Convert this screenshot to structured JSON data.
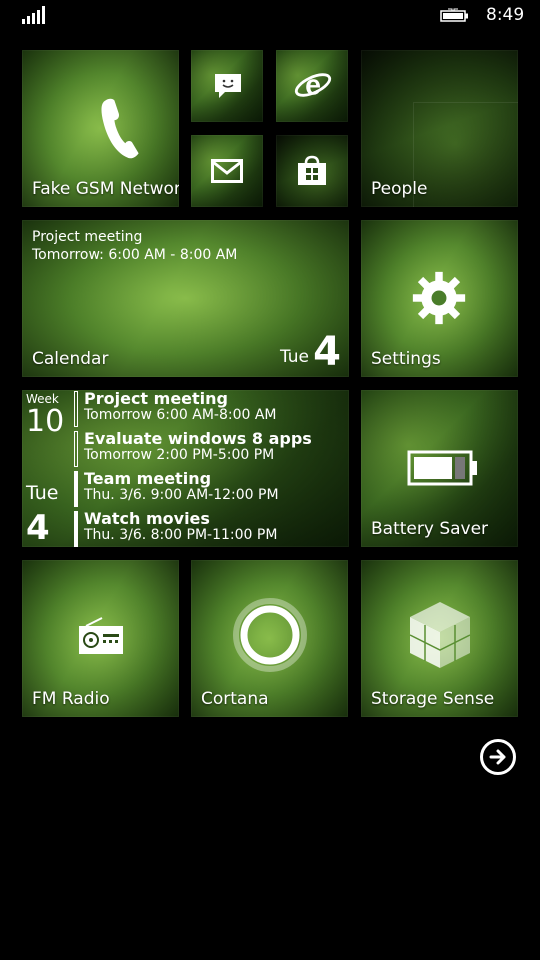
{
  "status_bar": {
    "time": "8:49",
    "icons": [
      "signal-icon",
      "battery-icon"
    ]
  },
  "tiles": {
    "phone": {
      "label": "Fake GSM Network",
      "icon": "phone-icon"
    },
    "messaging": {
      "icon": "messaging-icon"
    },
    "ie": {
      "icon": "internet-explorer-icon"
    },
    "mail": {
      "icon": "mail-icon"
    },
    "store": {
      "icon": "store-icon"
    },
    "people": {
      "label": "People"
    },
    "calendar": {
      "label": "Calendar",
      "event_title": "Project meeting",
      "event_time": "Tomorrow: 6:00 AM - 8:00 AM",
      "day": "Tue",
      "date": "4"
    },
    "settings": {
      "label": "Settings",
      "icon": "gear-icon"
    },
    "agenda": {
      "week_label": "Week",
      "week_number": "10",
      "day_of_week": "Tue",
      "day_number": "4",
      "events": [
        {
          "title": "Project meeting",
          "time": "Tomorrow 6:00 AM-8:00 AM"
        },
        {
          "title": "Evaluate windows 8 apps",
          "time": "Tomorrow 2:00 PM-5:00 PM"
        },
        {
          "title": "Team meeting",
          "time": "Thu. 3/6. 9:00 AM-12:00 PM"
        },
        {
          "title": "Watch movies",
          "time": "Thu. 3/6. 8:00 PM-11:00 PM"
        }
      ]
    },
    "battery_saver": {
      "label": "Battery Saver",
      "icon": "battery-icon"
    },
    "fm_radio": {
      "label": "FM Radio",
      "icon": "radio-icon"
    },
    "cortana": {
      "label": "Cortana",
      "icon": "cortana-circle-icon"
    },
    "storage_sense": {
      "label": "Storage Sense",
      "icon": "storage-cube-icon"
    }
  },
  "all_apps_button": {
    "icon": "arrow-right-circle-icon"
  },
  "colors": {
    "background": "#000000",
    "foreground": "#ffffff",
    "tile_green": "#4c7d2b"
  }
}
